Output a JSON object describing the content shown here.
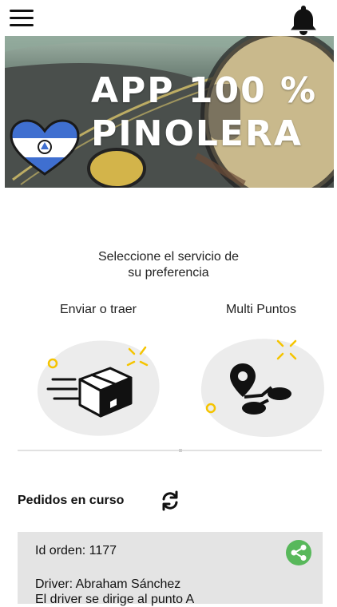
{
  "header": {
    "menu_icon": "hamburger-menu-icon",
    "notifications_icon": "bell-icon"
  },
  "banner": {
    "line1": "APP 100 %",
    "line2": "PINOLERA",
    "heart_flag_icon": "nicaragua-flag-heart-icon"
  },
  "prompt": {
    "line1": "Seleccione el servicio de",
    "line2": "su preferencia"
  },
  "services": [
    {
      "label": "Enviar o traer",
      "icon": "delivery-box-icon"
    },
    {
      "label": "Multi Puntos",
      "icon": "multi-point-route-icon"
    }
  ],
  "orders": {
    "title": "Pedidos en curso",
    "refresh_icon": "refresh-icon",
    "items": [
      {
        "id_text": "Id orden: 1177",
        "driver_text": "Driver: Abraham Sánchez",
        "status_text": "El driver se dirige al punto A",
        "share_icon": "share-icon"
      }
    ]
  },
  "colors": {
    "accent_green": "#58b85b",
    "flag_blue": "#3f6fd0",
    "sparkle_yellow": "#f5c400",
    "card_gray": "#e4e4e4"
  }
}
